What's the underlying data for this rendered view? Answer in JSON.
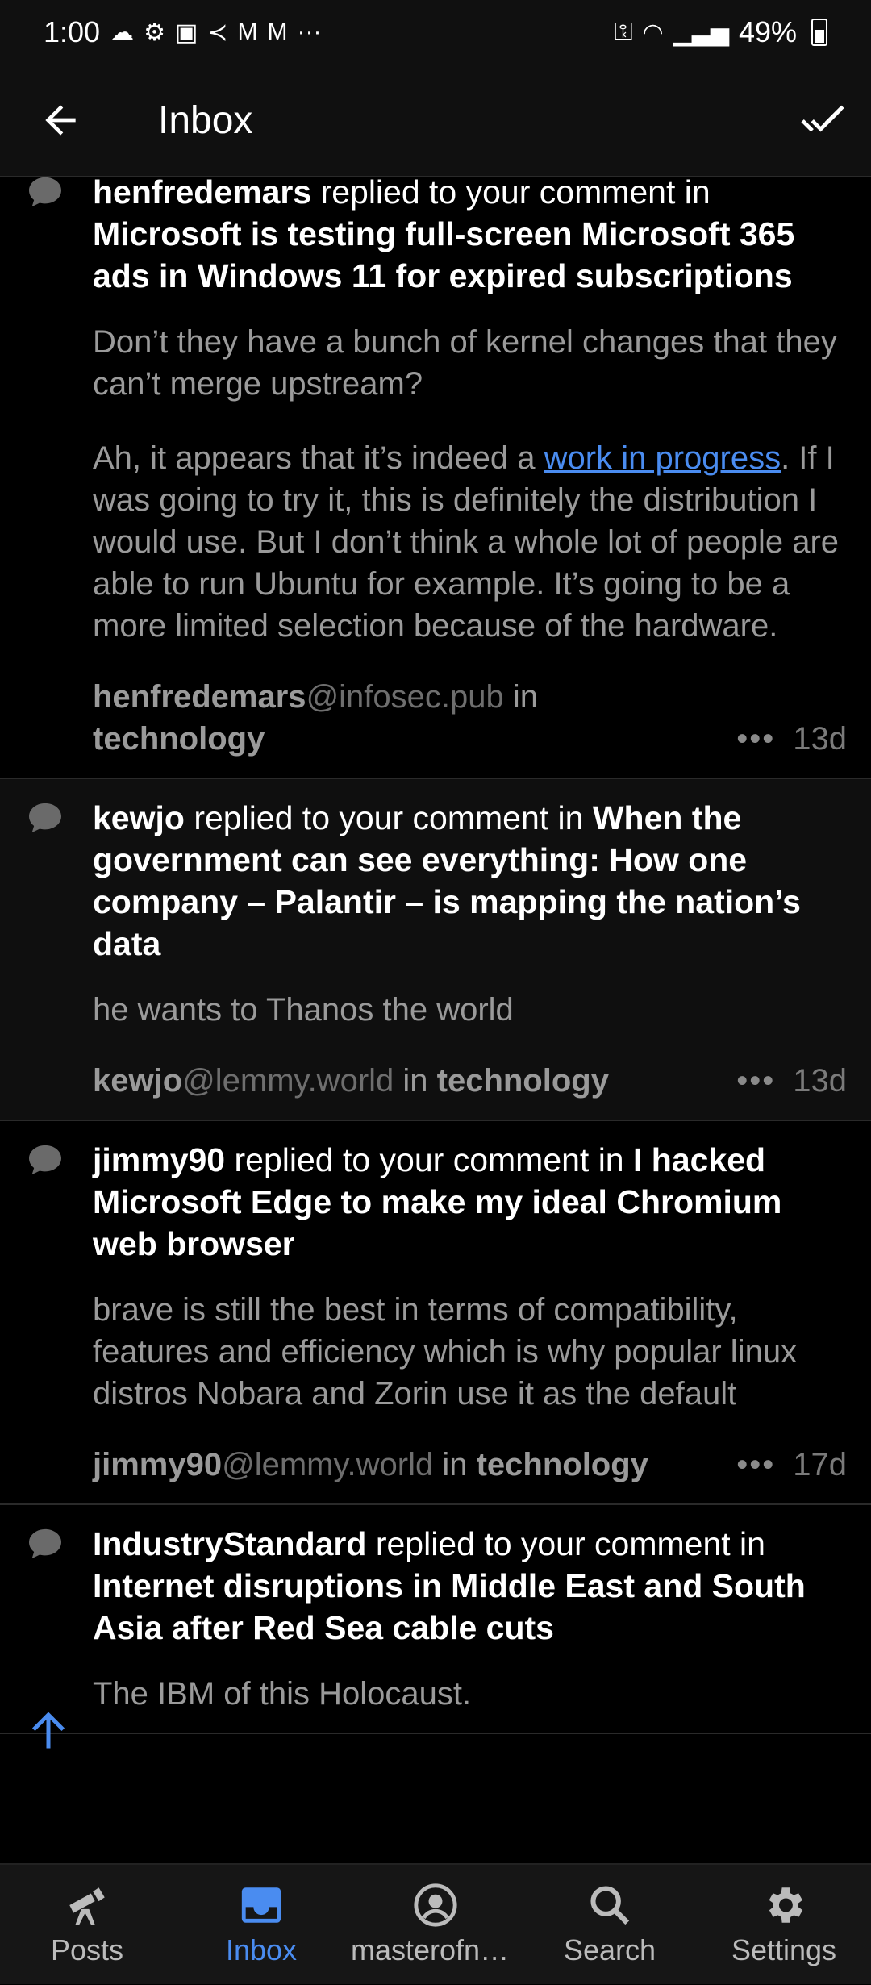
{
  "status_bar": {
    "time": "1:00",
    "battery": "49%"
  },
  "app_bar": {
    "title": "Inbox"
  },
  "notifications": [
    {
      "user": "henfredemars",
      "action": " replied to your comment in ",
      "post": "Microsoft is testing full-screen Microsoft 365 ads in Windows 11 for expired subscriptions",
      "body_p1": "Don’t they have a bunch of kernel changes that they can’t merge upstream?",
      "body_p2_pre": "Ah, it appears that it’s indeed a ",
      "body_p2_link": "work in progress",
      "body_p2_post": ". If I was going to try it, this is definitely the distribution I would use. But I don’t think a whole lot of people are able to run Ubuntu for example. It’s going to be a more limited selection because of the hardware.",
      "meta_user": "henfredemars",
      "meta_instance": "@infosec.pub",
      "meta_in": " in ",
      "meta_community": "technology",
      "age": "13d"
    },
    {
      "user": "kewjo",
      "action": " replied to your comment in ",
      "post": "When the government can see everything: How one company – Palantir – is mapping the nation’s data",
      "body": "he wants to Thanos the world",
      "meta_user": "kewjo",
      "meta_instance": "@lemmy.world",
      "meta_in": " in ",
      "meta_community": "technology",
      "age": "13d"
    },
    {
      "user": "jimmy90",
      "action": " replied to your comment in ",
      "post": "I hacked Microsoft Edge to make my ideal Chromium web browser",
      "body": "brave is still the best in terms of compatibility, features and efficiency which is why popular linux distros Nobara and Zorin use it as the default",
      "meta_user": "jimmy90",
      "meta_instance": "@lemmy.world",
      "meta_in": " in ",
      "meta_community": "technology",
      "age": "17d"
    },
    {
      "user": "IndustryStandard",
      "action": " replied to your comment in ",
      "post": "Internet disruptions in Middle East and South Asia after Red Sea cable cuts",
      "body": "The IBM of this Holocaust."
    }
  ],
  "more_dots": "•••",
  "bottom_nav": {
    "posts": "Posts",
    "inbox": "Inbox",
    "profile": "masterofn0…",
    "search": "Search",
    "settings": "Settings"
  },
  "colors": {
    "accent": "#4a8cf0",
    "background": "#000000",
    "muted_text": "#9a9a9a"
  }
}
